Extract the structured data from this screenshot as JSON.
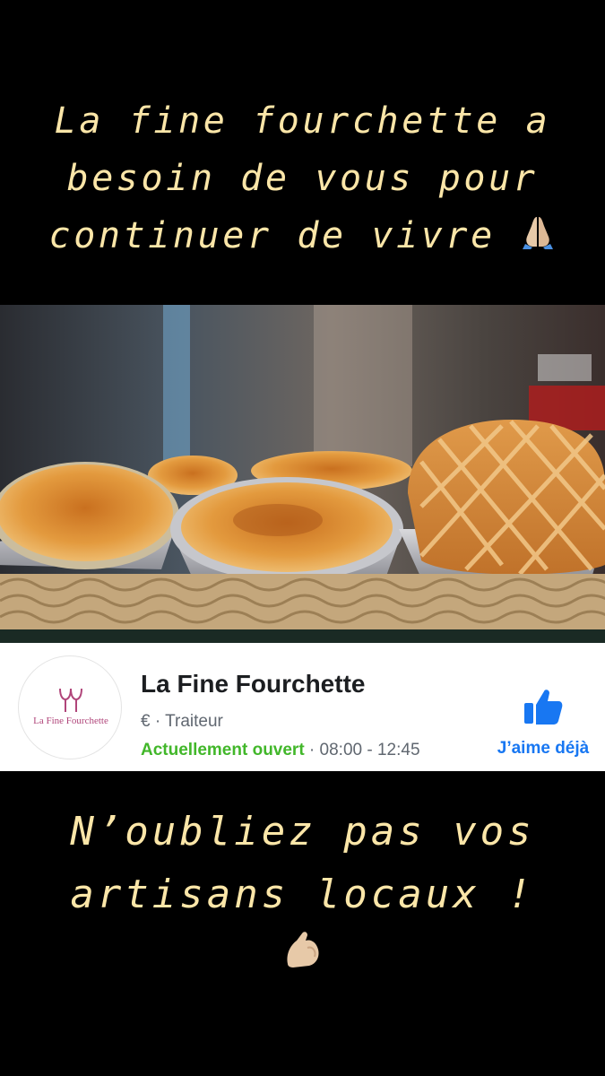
{
  "post": {
    "top_lines": [
      "La fine fourchette a",
      "besoin de vous pour",
      "continuer de vivre"
    ],
    "top_emoji": "folded-hands",
    "bottom_lines": [
      "N’oubliez pas vos",
      "artisans locaux !"
    ],
    "bottom_emoji": "flexed-biceps",
    "text_color": "#fbe6a8"
  },
  "photo": {
    "subject": "pastries-in-foil-trays-on-wicker-basket"
  },
  "page_card": {
    "logo_text": "La Fine Fourchette",
    "name": "La Fine Fourchette",
    "category": "€ · Traiteur",
    "open_status": "Actuellement ouvert",
    "hours": " · 08:00 - 12:45",
    "like_label": "J’aime déjà",
    "like_icon": "thumbs-up-icon",
    "brand_color": "#1877f2",
    "open_color": "#42b72a"
  }
}
